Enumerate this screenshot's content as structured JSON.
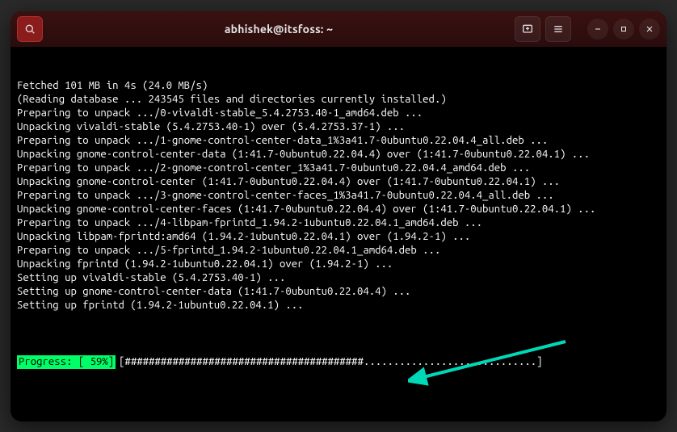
{
  "titlebar": {
    "title": "abhishek@itsfoss: ~",
    "icons": {
      "search": "search-icon",
      "new_tab": "new-tab-icon",
      "menu": "hamburger-icon",
      "minimize": "minimize-icon",
      "maximize": "maximize-icon",
      "close": "close-icon"
    }
  },
  "terminal": {
    "lines": [
      "Fetched 101 MB in 4s (24.0 MB/s)",
      "(Reading database ... 243545 files and directories currently installed.)",
      "Preparing to unpack .../0-vivaldi-stable_5.4.2753.40-1_amd64.deb ...",
      "Unpacking vivaldi-stable (5.4.2753.40-1) over (5.4.2753.37-1) ...",
      "Preparing to unpack .../1-gnome-control-center-data_1%3a41.7-0ubuntu0.22.04.4_all.deb ...",
      "Unpacking gnome-control-center-data (1:41.7-0ubuntu0.22.04.4) over (1:41.7-0ubuntu0.22.04.1) ...",
      "Preparing to unpack .../2-gnome-control-center_1%3a41.7-0ubuntu0.22.04.4_amd64.deb ...",
      "Unpacking gnome-control-center (1:41.7-0ubuntu0.22.04.4) over (1:41.7-0ubuntu0.22.04.1) ...",
      "Preparing to unpack .../3-gnome-control-center-faces_1%3a41.7-0ubuntu0.22.04.4_all.deb ...",
      "Unpacking gnome-control-center-faces (1:41.7-0ubuntu0.22.04.4) over (1:41.7-0ubuntu0.22.04.1) ...",
      "Preparing to unpack .../4-libpam-fprintd_1.94.2-1ubuntu0.22.04.1_amd64.deb ...",
      "Unpacking libpam-fprintd:amd64 (1.94.2-1ubuntu0.22.04.1) over (1.94.2-1) ...",
      "Preparing to unpack .../5-fprintd_1.94.2-1ubuntu0.22.04.1_amd64.deb ...",
      "Unpacking fprintd (1.94.2-1ubuntu0.22.04.1) over (1.94.2-1) ...",
      "Setting up vivaldi-stable (5.4.2753.40-1) ...",
      "Setting up gnome-control-center-data (1:41.7-0ubuntu0.22.04.4) ...",
      "Setting up fprintd (1.94.2-1ubuntu0.22.04.1) ..."
    ],
    "progress": {
      "label": "Progress: [ 59%]",
      "bar": "[########################################.............................]"
    }
  },
  "annotation": {
    "arrow_color": "#00d9b8"
  }
}
